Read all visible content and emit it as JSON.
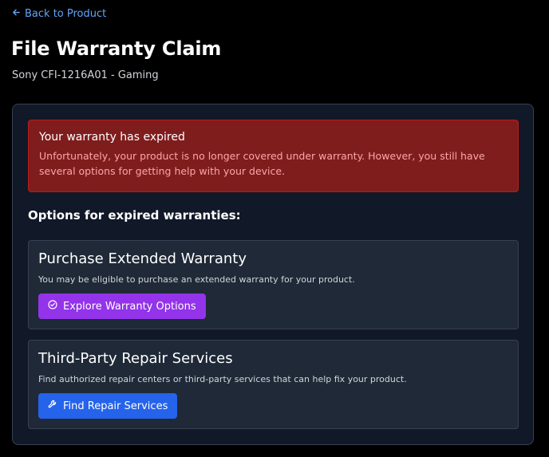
{
  "nav": {
    "back_label": "Back to Product",
    "back_icon": "arrow-left-icon"
  },
  "header": {
    "title": "File Warranty Claim",
    "product": "Sony CFI-1216A01 - Gaming"
  },
  "alert": {
    "title": "Your warranty has expired",
    "message": "Unfortunately, your product is no longer covered under warranty. However, you still have several options for getting help with your device.",
    "background_color": "#7f1d1d",
    "text_color": "#fca5a5"
  },
  "options_section": {
    "heading": "Options for expired warranties:",
    "options": [
      {
        "title": "Purchase Extended Warranty",
        "description": "You may be eligible to purchase an extended warranty for your product.",
        "button_label": "Explore Warranty Options",
        "button_icon": "check-circle-icon",
        "button_color": "#9333ea"
      },
      {
        "title": "Third-Party Repair Services",
        "description": "Find authorized repair centers or third-party services that can help fix your product.",
        "button_label": "Find Repair Services",
        "button_icon": "wrench-icon",
        "button_color": "#2563eb"
      }
    ]
  },
  "colors": {
    "page_background": "#000000",
    "card_background": "#111827",
    "option_background": "#1f2937",
    "link": "#60a5fa"
  }
}
